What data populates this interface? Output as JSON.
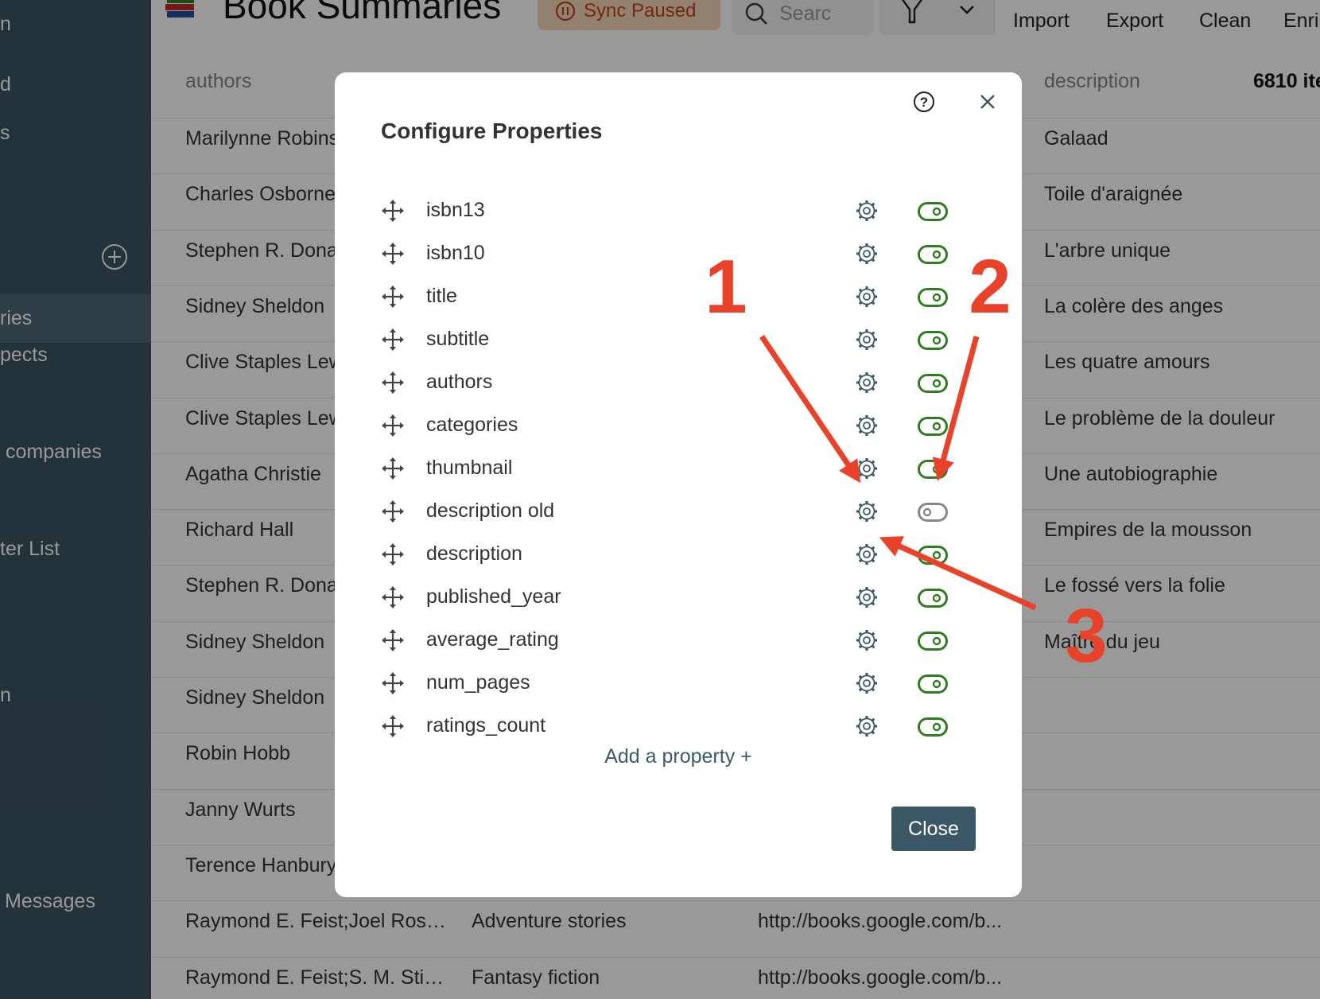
{
  "sidebar": {
    "items": [
      {
        "label": "n",
        "selected": false
      },
      {
        "label": "d",
        "selected": false
      },
      {
        "label": "s",
        "selected": false
      },
      {
        "label": "ries",
        "selected": true
      },
      {
        "label": "pects",
        "selected": false
      },
      {
        "label": "companies",
        "selected": false
      },
      {
        "label": "ter List",
        "selected": false
      },
      {
        "label": "n",
        "selected": false
      },
      {
        "label": "Messages",
        "selected": false
      }
    ],
    "add_icon": "plus-circle-icon",
    "ellipsis": ".."
  },
  "header": {
    "title": "Book Summaries",
    "sync_label": "Sync Paused",
    "search_placeholder": "Searc",
    "import": "Import",
    "export": "Export",
    "clean": "Clean",
    "enrich": "Enri"
  },
  "table": {
    "headers": {
      "authors": "authors",
      "description": "description"
    },
    "count": "6810 ite",
    "rows": [
      {
        "authors": "Marilynne Robinson",
        "categories": "",
        "thumbnail": "",
        "description": "Galaad"
      },
      {
        "authors": "Charles Osborne;",
        "categories": "",
        "thumbnail": "",
        "description": "Toile d'araignée"
      },
      {
        "authors": "Stephen R. Donaldson",
        "categories": "",
        "thumbnail": "",
        "description": "L'arbre unique"
      },
      {
        "authors": "Sidney Sheldon",
        "categories": "",
        "thumbnail": "",
        "description": "La colère des anges"
      },
      {
        "authors": "Clive Staples Lewis",
        "categories": "",
        "thumbnail": "",
        "description": "Les quatre amours"
      },
      {
        "authors": "Clive Staples Lewis",
        "categories": "",
        "thumbnail": "",
        "description": "Le problème de la douleur"
      },
      {
        "authors": "Agatha Christie",
        "categories": "",
        "thumbnail": "",
        "description": "Une autobiographie"
      },
      {
        "authors": "Richard Hall",
        "categories": "",
        "thumbnail": "",
        "description": "Empires de la mousson"
      },
      {
        "authors": "Stephen R. Donaldson",
        "categories": "",
        "thumbnail": "",
        "description": "Le fossé vers la folie"
      },
      {
        "authors": "Sidney Sheldon",
        "categories": "",
        "thumbnail": "",
        "description": "Maître du jeu"
      },
      {
        "authors": "Sidney Sheldon",
        "categories": "",
        "thumbnail": "",
        "description": ""
      },
      {
        "authors": "Robin Hobb",
        "categories": "",
        "thumbnail": "",
        "description": ""
      },
      {
        "authors": "Janny Wurts",
        "categories": "",
        "thumbnail": "",
        "description": ""
      },
      {
        "authors": "Terence Hanbury",
        "categories": "",
        "thumbnail": "",
        "description": ""
      },
      {
        "authors": "Raymond E. Feist;Joel Rose...",
        "categories": "Adventure stories",
        "thumbnail": "http://books.google.com/b...",
        "description": ""
      },
      {
        "authors": "Raymond E. Feist;S. M. Stirli...",
        "categories": "Fantasy fiction",
        "thumbnail": "http://books.google.com/b...",
        "description": ""
      }
    ]
  },
  "modal": {
    "title": "Configure Properties",
    "properties": [
      {
        "name": "isbn13",
        "enabled": true
      },
      {
        "name": "isbn10",
        "enabled": true
      },
      {
        "name": "title",
        "enabled": true
      },
      {
        "name": "subtitle",
        "enabled": true
      },
      {
        "name": "authors",
        "enabled": true
      },
      {
        "name": "categories",
        "enabled": true
      },
      {
        "name": "thumbnail",
        "enabled": true
      },
      {
        "name": "description old",
        "enabled": false
      },
      {
        "name": "description",
        "enabled": true
      },
      {
        "name": "published_year",
        "enabled": true
      },
      {
        "name": "average_rating",
        "enabled": true
      },
      {
        "name": "num_pages",
        "enabled": true
      },
      {
        "name": "ratings_count",
        "enabled": true
      }
    ],
    "add_property": "Add a property +",
    "close": "Close"
  },
  "annotations": {
    "labels": [
      "1",
      "2",
      "3"
    ],
    "color": "#e8432a"
  },
  "colors": {
    "toggle_on": "#2e7d1f",
    "toggle_off": "#888888",
    "primary": "#3b5866",
    "sync": "#c0431e"
  }
}
